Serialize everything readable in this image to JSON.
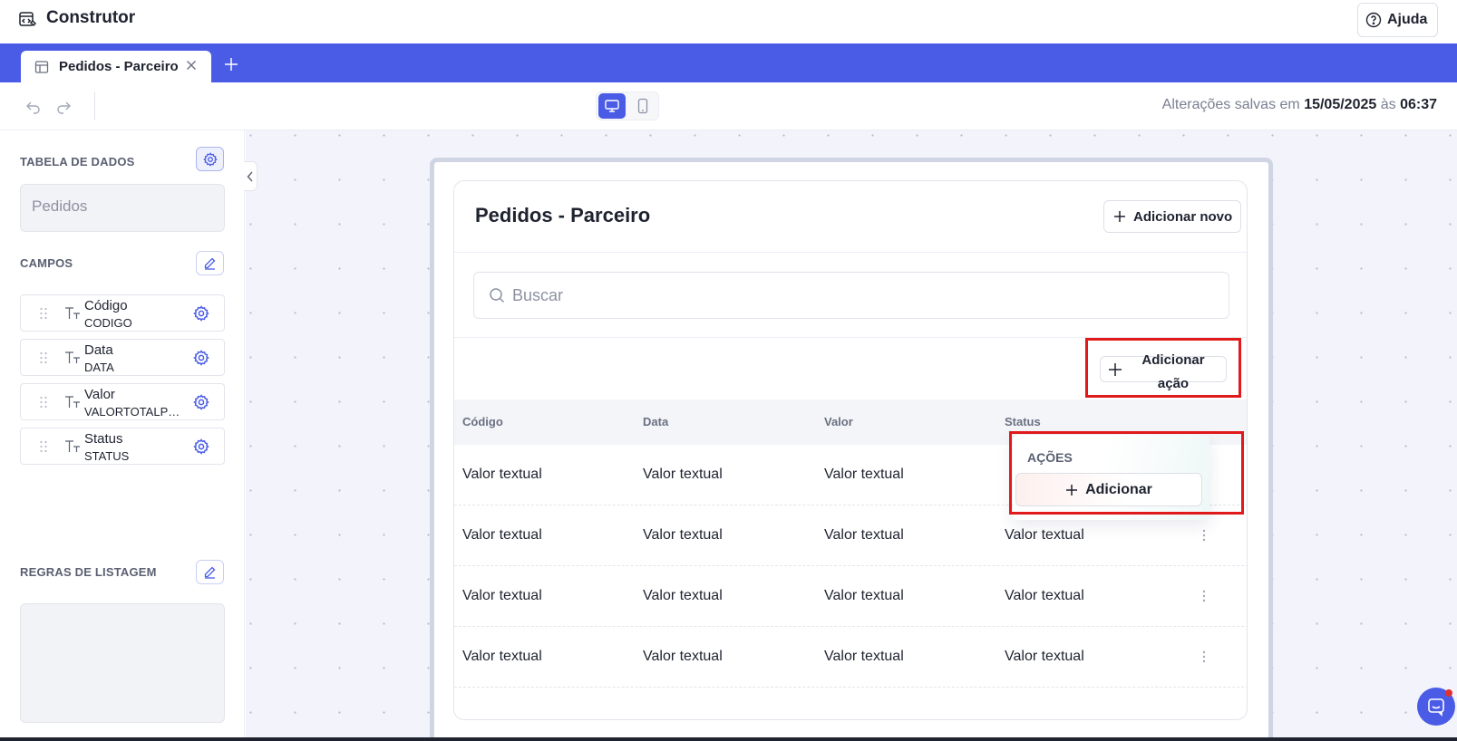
{
  "app": {
    "title": "Construtor",
    "help_label": "Ajuda"
  },
  "tabs": [
    {
      "label": "Pedidos - Parceiro"
    }
  ],
  "toolbar": {
    "saved_prefix": "Alterações salvas em",
    "saved_date": "15/05/2025",
    "saved_connector": "às",
    "saved_time": "06:37"
  },
  "sidebar": {
    "data_table_title": "TABELA DE DADOS",
    "data_table_value": "Pedidos",
    "fields_title": "CAMPOS",
    "fields": [
      {
        "name": "Código",
        "key": "CODIGO"
      },
      {
        "name": "Data",
        "key": "DATA"
      },
      {
        "name": "Valor",
        "key": "VALORTOTALPE..."
      },
      {
        "name": "Status",
        "key": "STATUS"
      }
    ],
    "rules_title": "REGRAS DE LISTAGEM"
  },
  "page": {
    "title": "Pedidos - Parceiro",
    "add_new_label": "Adicionar novo",
    "search_placeholder": "Buscar",
    "add_action_label": "Adicionar ação",
    "columns": [
      "Código",
      "Data",
      "Valor",
      "Status"
    ],
    "rows": [
      [
        "Valor textual",
        "Valor textual",
        "Valor textual",
        ""
      ],
      [
        "Valor textual",
        "Valor textual",
        "Valor textual",
        "Valor textual"
      ],
      [
        "Valor textual",
        "Valor textual",
        "Valor textual",
        "Valor textual"
      ],
      [
        "Valor textual",
        "Valor textual",
        "Valor textual",
        "Valor textual"
      ]
    ],
    "actions_popover": {
      "title": "AÇÕES",
      "add_label": "Adicionar"
    }
  },
  "colors": {
    "brand": "#4a5ce6",
    "highlight": "#e0191b"
  }
}
